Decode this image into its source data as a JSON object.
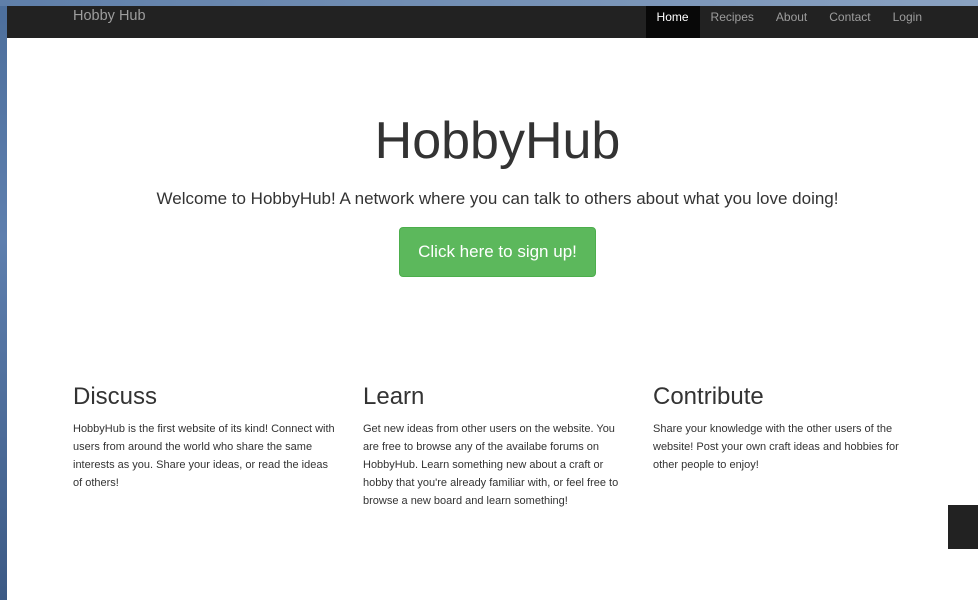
{
  "navbar": {
    "brand": "Hobby Hub",
    "items": [
      {
        "label": "Home",
        "active": true
      },
      {
        "label": "Recipes",
        "active": false
      },
      {
        "label": "About",
        "active": false
      },
      {
        "label": "Contact",
        "active": false
      },
      {
        "label": "Login",
        "active": false
      }
    ]
  },
  "hero": {
    "title": "HobbyHub",
    "subtitle": "Welcome to HobbyHub! A network where you can talk to others about what you love doing!",
    "button_label": "Click here to sign up!"
  },
  "columns": [
    {
      "heading": "Discuss",
      "text": "HobbyHub is the first website of its kind! Connect with users from around the world who share the same interests as you. Share your ideas, or read the ideas of others!"
    },
    {
      "heading": "Learn",
      "text": "Get new ideas from other users on the website. You are free to browse any of the availabe forums on HobbyHub. Learn something new about a craft or hobby that you're already familiar with, or feel free to browse a new board and learn something!"
    },
    {
      "heading": "Contribute",
      "text": "Share your knowledge with the other users of the website! Post your own craft ideas and hobbies for other people to enjoy!"
    }
  ],
  "colors": {
    "navbar_bg": "#222222",
    "nav_active_bg": "#080808",
    "button_bg": "#5cb85c"
  }
}
